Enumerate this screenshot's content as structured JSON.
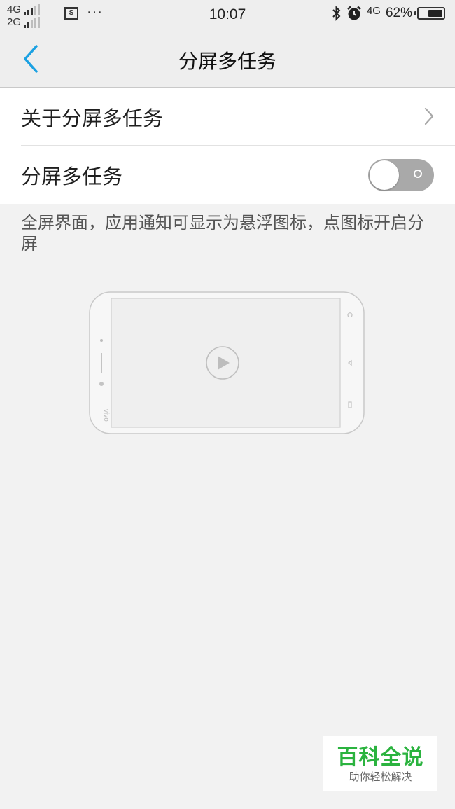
{
  "status_bar": {
    "network_top": "4G",
    "network_bottom": "2G",
    "screenshot_icon_label": "S",
    "more": "···",
    "time": "10:07",
    "mobile_data": "4G",
    "battery": "62%",
    "battery_level": 0.62,
    "icons": [
      "signal-icon",
      "screenshot-icon",
      "more-icon",
      "bluetooth-icon",
      "alarm-icon",
      "battery-icon"
    ]
  },
  "header": {
    "title": "分屏多任务",
    "back_icon": "chevron-left-icon"
  },
  "settings": {
    "about_label": "关于分屏多任务",
    "toggle_label": "分屏多任务",
    "toggle_on": false
  },
  "description": "全屏界面，应用通知可显示为悬浮图标，点图标开启分屏",
  "illustration": {
    "brand": "vivo",
    "play_icon": "play-icon"
  },
  "watermark": {
    "title": "百科全说",
    "subtitle": "助你轻松解决"
  },
  "colors": {
    "accent": "#1ba1e2",
    "toggle_off": "#a9a9a9",
    "watermark_green": "#2bb33f"
  }
}
